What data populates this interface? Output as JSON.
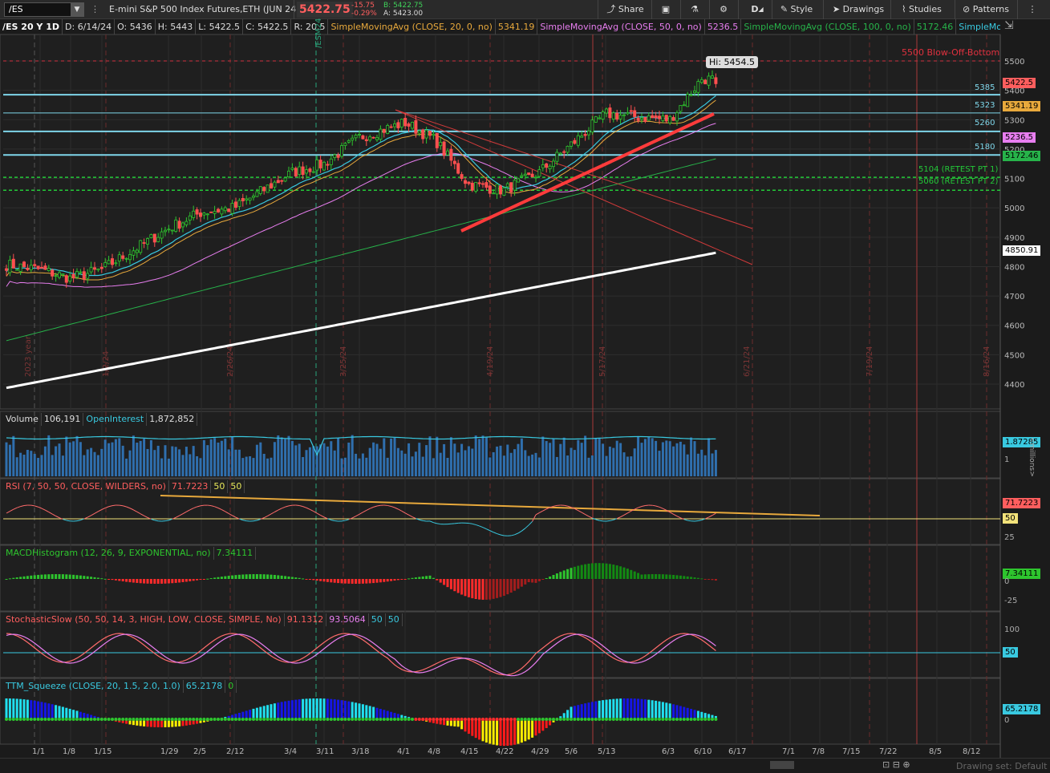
{
  "toolbar": {
    "symbol": "/ES",
    "description": "E-mini S&P 500 Index Futures,ETH (JUN 24)",
    "last": "5422.75",
    "change": "-15.75",
    "change_pct": "-0.29%",
    "bid": "B: 5422.75",
    "ask": "A: 5423.00",
    "share": "Share",
    "period": "D",
    "style": "Style",
    "drawings": "Drawings",
    "studies": "Studies",
    "patterns": "Patterns"
  },
  "infobar": {
    "chart": "/ES 20 Y 1D",
    "date": "D: 6/14/24",
    "open": "O: 5436",
    "high": "H: 5443",
    "low": "L: 5422.5",
    "close": "C: 5422.5",
    "range": "R: 20.5",
    "sma20_label": "SimpleMovingAvg (CLOSE, 20, 0, no)",
    "sma20_value": "5341.19",
    "sma50_label": "SimpleMovingAvg (CLOSE, 50, 0, no)",
    "sma50_value": "5236.5",
    "sma100_label": "SimpleMovingAvg (CLOSE, 100, 0, no)",
    "sma100_value": "5172.46",
    "sma200_label": "SimpleMovingAvg ..."
  },
  "price_pane": {
    "hi_label": "Hi: 5454.5",
    "blowoff_label": "5500 Blow-Off-Bottom",
    "retest1_label": "5104 (RETEST PT 1)",
    "retest2_label": "5060 (RETEST PT 2)",
    "level_5385": "5385",
    "level_5323": "5323",
    "level_5260": "5260",
    "level_5180": "5180",
    "tag_last": "5422.5",
    "tag_sma20": "5341.19",
    "tag_sma50": "5236.5",
    "tag_sma100": "5172.46",
    "tag_sma200": "4850.91",
    "vertical_labels": [
      "1/2/24",
      "2/26/24",
      "3/25/24",
      "4/19/24",
      "5/17/24",
      "6/21/24",
      "7/19/24",
      "8/16/24",
      "/ESM24",
      "2023 year"
    ]
  },
  "volume_pane": {
    "title": "Volume",
    "volume": "106,191",
    "oi_label": "OpenInterest",
    "oi": "1,872,852",
    "tag": "1.87285",
    "ticks": [
      "1"
    ],
    "units": "<millions>"
  },
  "rsi_pane": {
    "title": "RSI (7, 50, 50, CLOSE, WILDERS, no)",
    "value": "71.7223",
    "ob": "50",
    "os": "50",
    "tag": "71.7223",
    "tag50": "50",
    "ticks": [
      "25"
    ]
  },
  "macd_pane": {
    "title": "MACDHistogram (12, 26, 9, EXPONENTIAL, no)",
    "value": "7.34111",
    "tag": "7.34111",
    "ticks": [
      "0",
      "-25"
    ]
  },
  "stoch_pane": {
    "title": "StochasticSlow (50, 50, 14, 3, HIGH, LOW, CLOSE, SIMPLE, No)",
    "k": "91.1312",
    "d": "93.5064",
    "ob": "50",
    "os": "50",
    "tag50": "50",
    "ticks": [
      "100"
    ]
  },
  "squeeze_pane": {
    "title": "TTM_Squeeze (CLOSE, 20, 1.5, 2.0, 1.0)",
    "value": "65.2178",
    "alert": "0",
    "tag": "65.2178",
    "ticks": [
      "0"
    ]
  },
  "footer": {
    "drawing_set": "Drawing set: Default"
  },
  "chart_data": {
    "type": "candlestick",
    "title": "/ES 20 Y 1D",
    "y_axis_ticks": [
      5500,
      5400,
      5300,
      5200,
      5100,
      5000,
      4900,
      4800,
      4700,
      4600,
      4500,
      4400
    ],
    "x_axis_ticks": [
      "1/1",
      "1/8",
      "1/15",
      "1/29",
      "2/5",
      "2/12",
      "3/4",
      "3/11",
      "3/18",
      "4/1",
      "4/8",
      "4/15",
      "4/22",
      "4/29",
      "5/6",
      "5/13",
      "6/3",
      "6/10",
      "6/17",
      "7/1",
      "7/8",
      "7/15",
      "7/22",
      "8/5",
      "8/12"
    ],
    "ylim": [
      4350,
      5560
    ],
    "last_bar": {
      "date": "6/14/24",
      "open": 5436,
      "high": 5443,
      "low": 5422.5,
      "close": 5422.5
    },
    "closes_sampled": [
      {
        "x": "1/1",
        "close": 4790
      },
      {
        "x": "1/8",
        "close": 4760
      },
      {
        "x": "1/15",
        "close": 4790
      },
      {
        "x": "1/29",
        "close": 4930
      },
      {
        "x": "2/5",
        "close": 4985
      },
      {
        "x": "2/12",
        "close": 5000
      },
      {
        "x": "3/4",
        "close": 5120
      },
      {
        "x": "3/11",
        "close": 5150
      },
      {
        "x": "3/18",
        "close": 5240
      },
      {
        "x": "4/1",
        "close": 5290
      },
      {
        "x": "4/8",
        "close": 5230
      },
      {
        "x": "4/15",
        "close": 5080
      },
      {
        "x": "4/22",
        "close": 5060
      },
      {
        "x": "4/29",
        "close": 5120
      },
      {
        "x": "5/6",
        "close": 5220
      },
      {
        "x": "5/13",
        "close": 5320
      },
      {
        "x": "6/3",
        "close": 5300
      },
      {
        "x": "6/10",
        "close": 5440
      }
    ],
    "series": [
      {
        "name": "SimpleMovingAvg (CLOSE, 20, 0, no)",
        "last": 5341.19,
        "color": "#e8a93c"
      },
      {
        "name": "SimpleMovingAvg (CLOSE, 50, 0, no)",
        "last": 5236.5,
        "color": "#e87ef0"
      },
      {
        "name": "SimpleMovingAvg (CLOSE, 100, 0, no)",
        "last": 5172.46,
        "color": "#27b34a"
      },
      {
        "name": "SimpleMovingAvg ...",
        "last": 4850.91,
        "color": "#ffffff"
      }
    ],
    "horizontal_levels": [
      5500,
      5385,
      5323,
      5260,
      5180,
      5104,
      5060
    ],
    "annotations": [
      "Hi: 5454.5",
      "5500 Blow-Off-Bottom",
      "5104 (RETEST PT 1)",
      "5060 (RETEST PT 2)"
    ],
    "grid": true
  },
  "colors": {
    "up": "#2ec52e",
    "down": "#ff4f4f",
    "cyan": "#39c9e0",
    "level": "#7fd6ea",
    "background": "#1b1b1b"
  }
}
